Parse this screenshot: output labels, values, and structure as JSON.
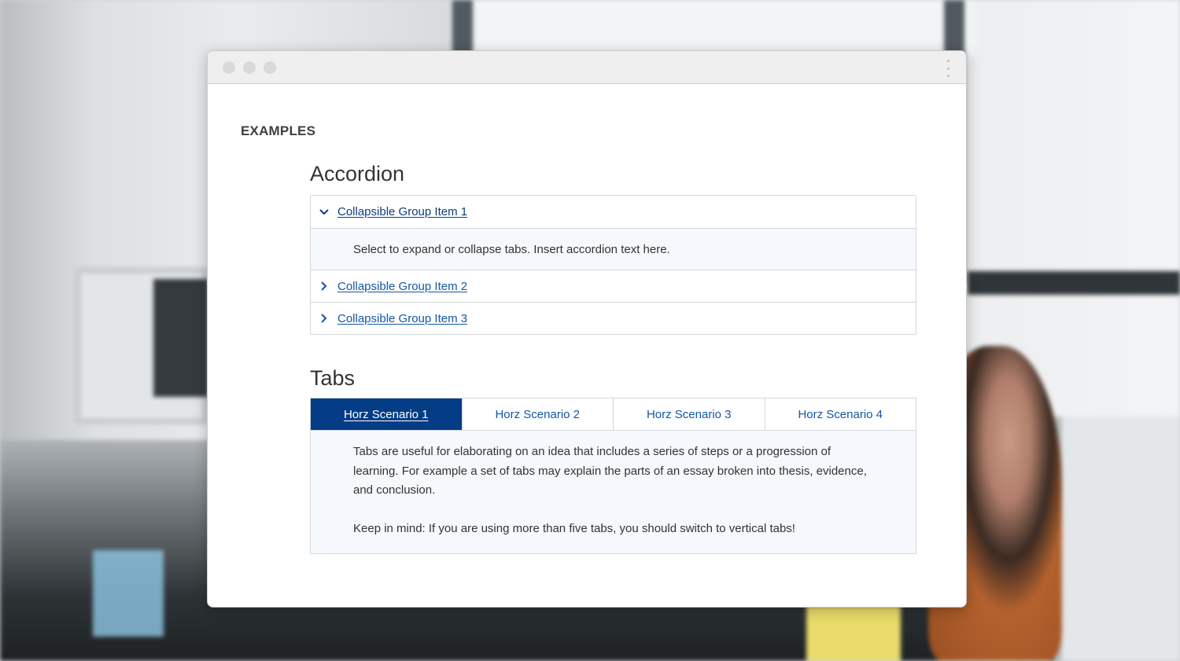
{
  "page": {
    "eyebrow": "EXAMPLES"
  },
  "accordion": {
    "title": "Accordion",
    "items": [
      {
        "label": "Collapsible Group Item 1",
        "expanded": true,
        "body": "Select to expand or collapse tabs. Insert accordion text here."
      },
      {
        "label": "Collapsible Group Item 2",
        "expanded": false
      },
      {
        "label": "Collapsible Group Item 3",
        "expanded": false
      }
    ]
  },
  "tabs": {
    "title": "Tabs",
    "items": [
      {
        "label": "Horz Scenario 1",
        "active": true
      },
      {
        "label": "Horz Scenario 2",
        "active": false
      },
      {
        "label": "Horz Scenario 3",
        "active": false
      },
      {
        "label": "Horz Scenario 4",
        "active": false
      }
    ],
    "panel": {
      "paragraph1": "Tabs are useful for elaborating on an idea that includes a series of steps or a progression of learning. For example a set of tabs may explain the parts of an essay broken into thesis, evidence, and conclusion.",
      "paragraph2": "Keep in mind: If you are using more than five tabs, you should switch to vertical tabs!"
    }
  },
  "colors": {
    "accent": "#043d86",
    "link": "#1357a6",
    "panel_bg": "#f5f8fc"
  },
  "icons": {
    "expanded": "chevron-down-icon",
    "collapsed": "chevron-right-icon"
  }
}
